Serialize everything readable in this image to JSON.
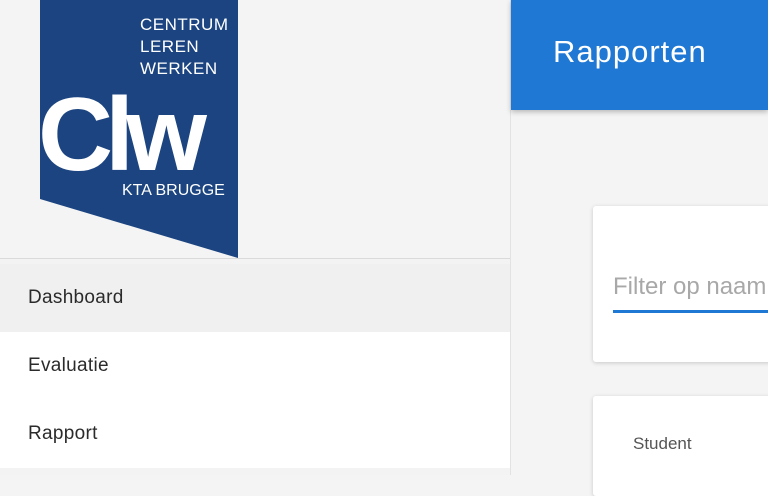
{
  "logo": {
    "line1": "CENTRUM",
    "line2": "LEREN",
    "line3": "WERKEN",
    "mark": "Clw",
    "subtitle": "KTA BRUGGE",
    "color": "#1b4480"
  },
  "sidebar": {
    "items": [
      {
        "label": "Dashboard",
        "active": true
      },
      {
        "label": "Evaluatie",
        "active": false
      },
      {
        "label": "Rapport",
        "active": false
      }
    ]
  },
  "header": {
    "title": "Rapporten",
    "color": "#1f78d4"
  },
  "filter": {
    "placeholder": "Filter op naam"
  },
  "table": {
    "columns": [
      "Student"
    ]
  }
}
